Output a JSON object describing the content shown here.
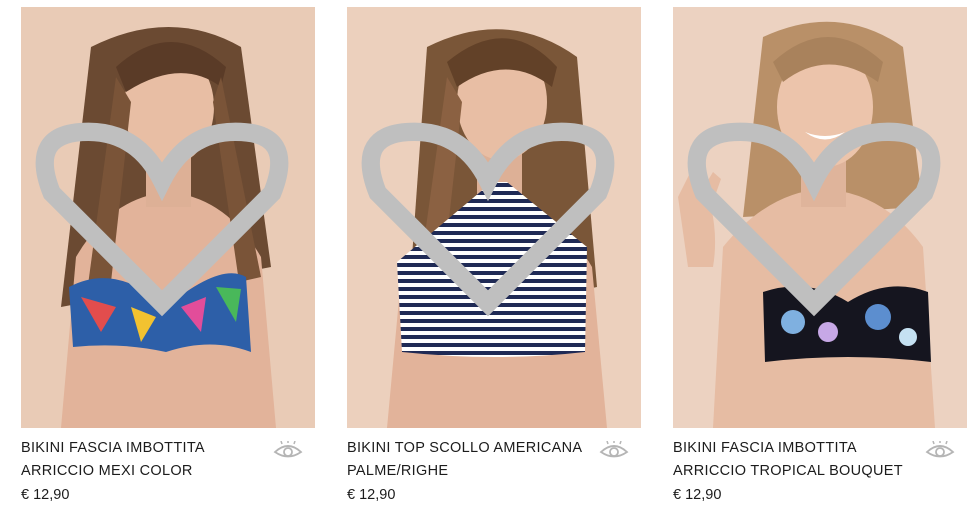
{
  "products": [
    {
      "name_line1": "BIKINI FASCIA IMBOTTITA",
      "name_line2": "ARRICCIO MEXI COLOR",
      "price": "€ 12,90",
      "colors": {
        "bg": "#e9cbb6",
        "top": "#2d5fa8"
      }
    },
    {
      "name_line1": "BIKINI TOP SCOLLO AMERICANA",
      "name_line2": "PALME/RIGHE",
      "price": "€ 12,90",
      "colors": {
        "bg": "#ecd0bd",
        "top": "#1f2a55"
      }
    },
    {
      "name_line1": "BIKINI FASCIA IMBOTTITA",
      "name_line2": "ARRICCIO TROPICAL BOUQUET",
      "price": "€ 12,90",
      "colors": {
        "bg": "#ecd2c1",
        "top": "#15151f"
      }
    }
  ],
  "icons": {
    "wishlist": "heart-outline-icon",
    "quick_view": "eye-icon"
  }
}
